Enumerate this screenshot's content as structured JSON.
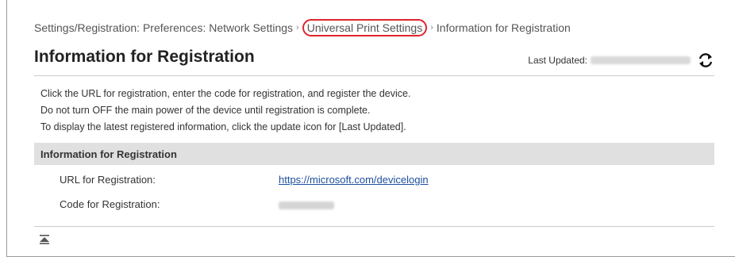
{
  "breadcrumb": {
    "items": [
      "Settings/Registration: Preferences: Network Settings",
      "Universal Print Settings",
      "Information for Registration"
    ],
    "separator": "›"
  },
  "page_title": "Information for Registration",
  "last_updated": {
    "label": "Last Updated:",
    "value_hidden": true
  },
  "description": {
    "line1": "Click the URL for registration, enter the code for registration, and register the device.",
    "line2": "Do not turn OFF the main power of the device until registration is complete.",
    "line3": "To display the latest registered information, click the update icon for [Last Updated]."
  },
  "section": {
    "title": "Information for Registration",
    "rows": [
      {
        "label": "URL for Registration:",
        "value": "https://microsoft.com/devicelogin"
      },
      {
        "label": "Code for Registration:",
        "value_hidden": true
      }
    ]
  },
  "icons": {
    "refresh": "refresh-icon",
    "back_to_top": "back-to-top-icon"
  },
  "colors": {
    "highlight_ring": "#e0242b",
    "link": "#1d4e9e",
    "section_bg": "#e0e0e0"
  }
}
